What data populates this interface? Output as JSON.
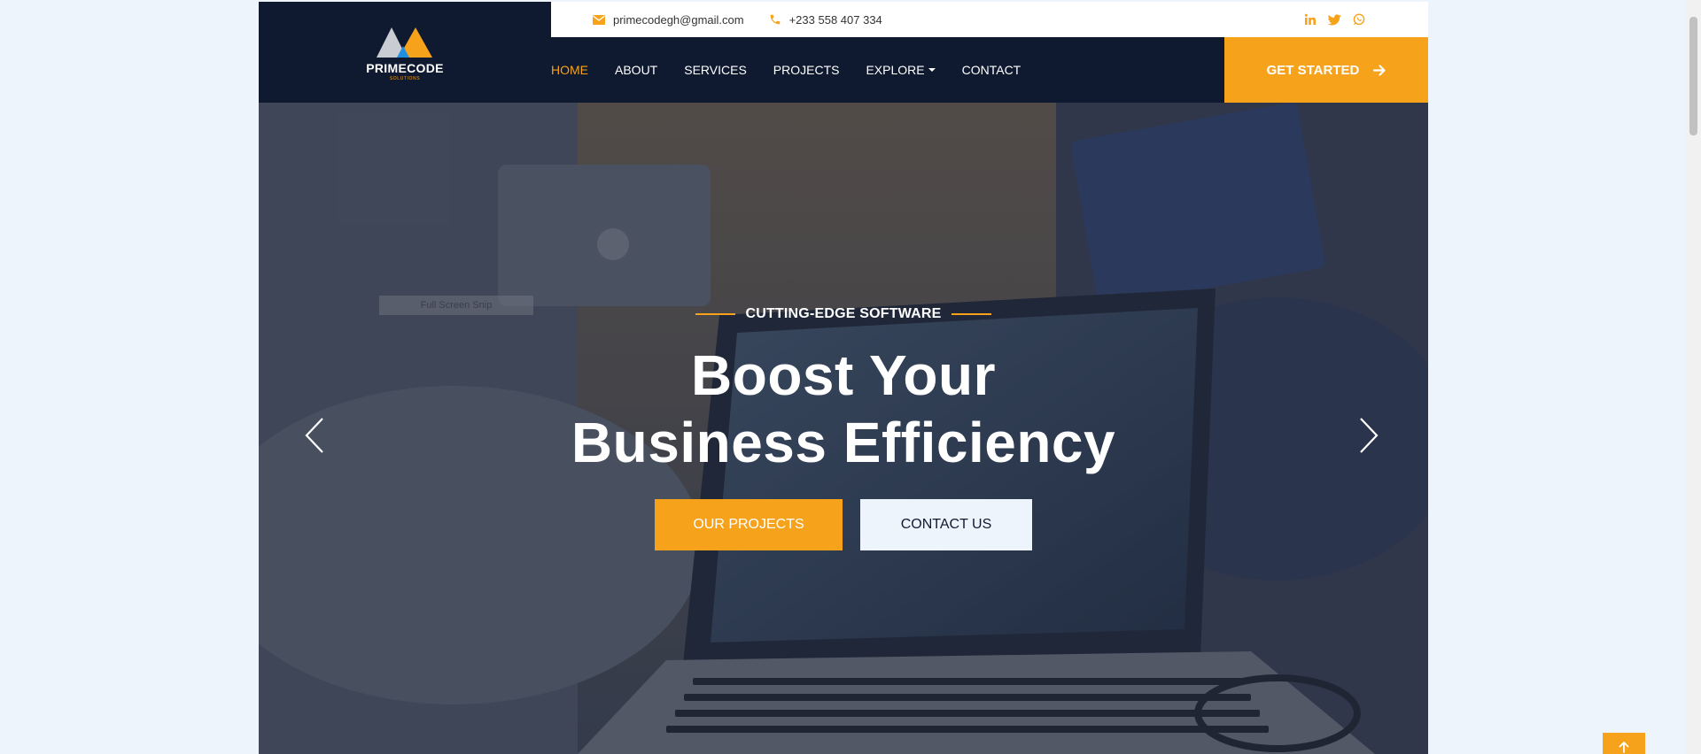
{
  "brand": {
    "name": "PRIMECODE",
    "tagline": "SOLUTIONS"
  },
  "topbar": {
    "email": "primecodegh@gmail.com",
    "phone": "+233 558 407 334",
    "socials": [
      "linkedin-icon",
      "twitter-icon",
      "whatsapp-icon"
    ]
  },
  "nav": {
    "items": [
      {
        "label": "HOME",
        "active": true
      },
      {
        "label": "ABOUT"
      },
      {
        "label": "SERVICES"
      },
      {
        "label": "PROJECTS"
      },
      {
        "label": "EXPLORE",
        "dropdown": true
      },
      {
        "label": "CONTACT"
      }
    ],
    "cta": "GET STARTED"
  },
  "hero": {
    "eyebrow": "CUTTING-EDGE SOFTWARE",
    "headline_line1": "Boost Your",
    "headline_line2": "Business Efficiency",
    "primary_button": "OUR PROJECTS",
    "secondary_button": "CONTACT US",
    "ghost_tag": "Full Screen Snip"
  },
  "colors": {
    "accent": "#f7a21b",
    "navy": "#0f1a30",
    "page_bg": "#eef4fb"
  }
}
